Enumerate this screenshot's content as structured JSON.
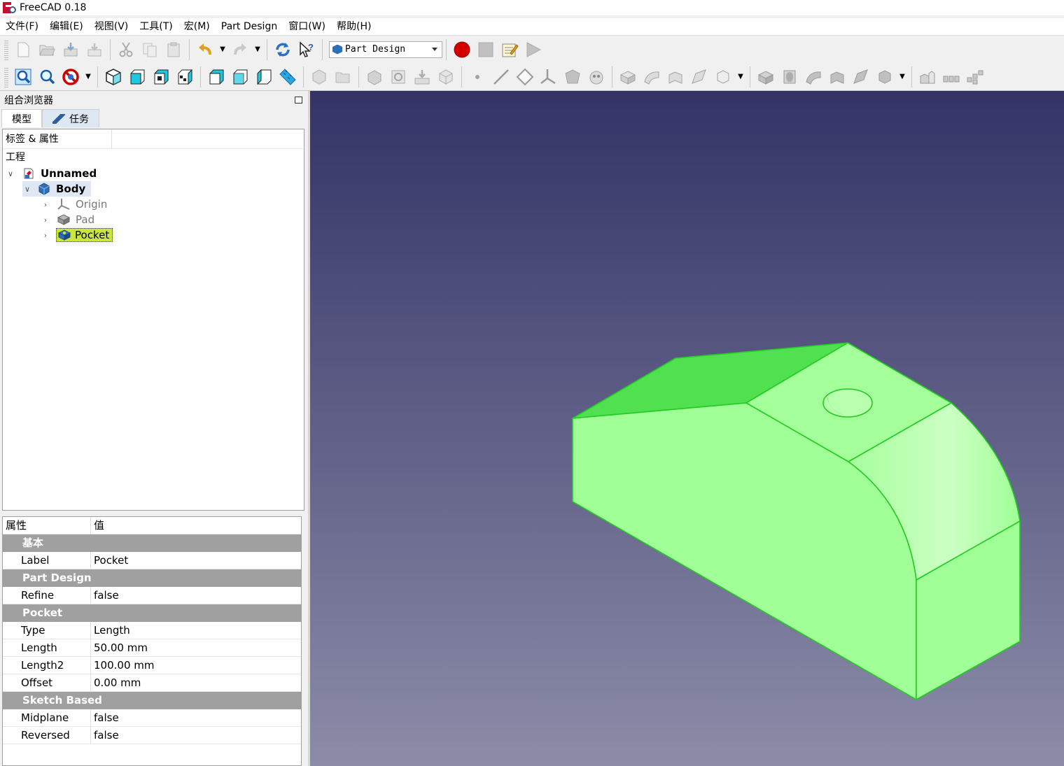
{
  "window": {
    "title": "FreeCAD 0.18"
  },
  "menu": [
    "文件(F)",
    "编辑(E)",
    "视图(V)",
    "工具(T)",
    "宏(M)",
    "Part Design",
    "窗口(W)",
    "帮助(H)"
  ],
  "workbench": {
    "selected": "Part Design"
  },
  "combo_view": {
    "title": "组合浏览器",
    "tabs": [
      "模型",
      "任务"
    ],
    "tree_header": "标签 & 属性",
    "tree_group": "工程",
    "tree": {
      "document": "Unnamed",
      "body": "Body",
      "origin": "Origin",
      "pad": "Pad",
      "pocket": "Pocket"
    }
  },
  "properties": {
    "header_key": "属性",
    "header_value": "值",
    "groups": [
      {
        "name": "基本",
        "rows": [
          {
            "key": "Label",
            "value": "Pocket"
          }
        ]
      },
      {
        "name": "Part Design",
        "rows": [
          {
            "key": "Refine",
            "value": "false"
          }
        ]
      },
      {
        "name": "Pocket",
        "rows": [
          {
            "key": "Type",
            "value": "Length"
          },
          {
            "key": "Length",
            "value": "50.00 mm"
          },
          {
            "key": "Length2",
            "value": "100.00 mm"
          },
          {
            "key": "Offset",
            "value": "0.00 mm"
          }
        ]
      },
      {
        "name": "Sketch Based",
        "rows": [
          {
            "key": "Midplane",
            "value": "false"
          },
          {
            "key": "Reversed",
            "value": "false"
          }
        ]
      }
    ]
  },
  "colors": {
    "selection": "#c8e63c",
    "model_face": "#a0ff96",
    "model_edge": "#22cc22",
    "viewport_top": "#333366",
    "viewport_bottom": "#8c8ca8"
  }
}
